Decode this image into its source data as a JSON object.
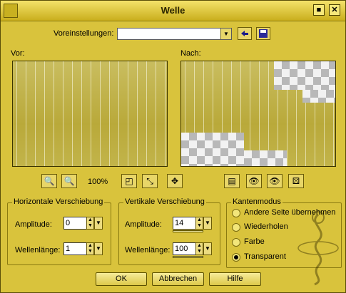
{
  "window": {
    "title": "Welle"
  },
  "presets": {
    "label": "Voreinstellungen:",
    "value": ""
  },
  "preview": {
    "before_label": "Vor:",
    "after_label": "Nach:"
  },
  "toolbar": {
    "zoom": "100%"
  },
  "horizontal": {
    "title": "Horizontale Verschiebung",
    "amplitude_label": "Amplitude:",
    "amplitude": "0",
    "wavelength_label": "Wellenlänge:",
    "wavelength": "1"
  },
  "vertical": {
    "title": "Vertikale Verschiebung",
    "amplitude_label": "Amplitude:",
    "amplitude": "14",
    "wavelength_label": "Wellenlänge:",
    "wavelength": "100"
  },
  "edge_mode": {
    "title": "Kantenmodus",
    "options": [
      "Andere Seite übernehmen",
      "Wiederholen",
      "Farbe",
      "Transparent"
    ],
    "selected": "Transparent"
  },
  "buttons": {
    "ok": "OK",
    "cancel": "Abbrechen",
    "help": "Hilfe"
  }
}
